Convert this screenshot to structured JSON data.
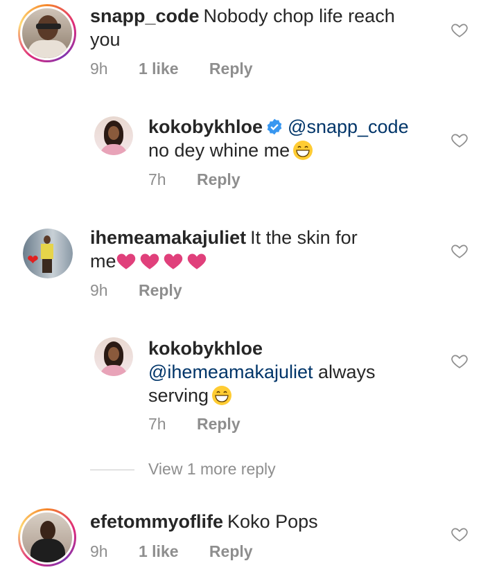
{
  "comments": [
    {
      "username": "snapp_code",
      "text_line1": "Nobody chop life reach",
      "text_line2": "you",
      "time": "9h",
      "likes": "1 like",
      "reply": "Reply"
    },
    {
      "username": "kokobykhloe",
      "mention": "@snapp_code",
      "text": "no dey whine me",
      "time": "7h",
      "reply": "Reply"
    },
    {
      "username": "ihemeamakajuliet",
      "text_line1": "It the skin for",
      "text_line2": "me",
      "time": "9h",
      "reply": "Reply"
    },
    {
      "username": "kokobykhloe",
      "mention": "@ihemeamakajuliet",
      "text_line1": "always",
      "text_line2": "serving",
      "time": "7h",
      "reply": "Reply"
    },
    {
      "username": "efetommyoflife",
      "text": "Koko Pops",
      "time": "9h",
      "likes": "1 like",
      "reply": "Reply"
    }
  ],
  "view_more": "View 1 more reply",
  "icons": {
    "like": "heart-outline-icon",
    "verified": "verified-badge-icon",
    "emoji": "grinning-face-emoji",
    "pink_heart": "pink-heart-emoji"
  },
  "colors": {
    "mention": "#003569",
    "meta": "#8e8e8e",
    "pink": "#e0407b",
    "verified": "#3897f0"
  }
}
